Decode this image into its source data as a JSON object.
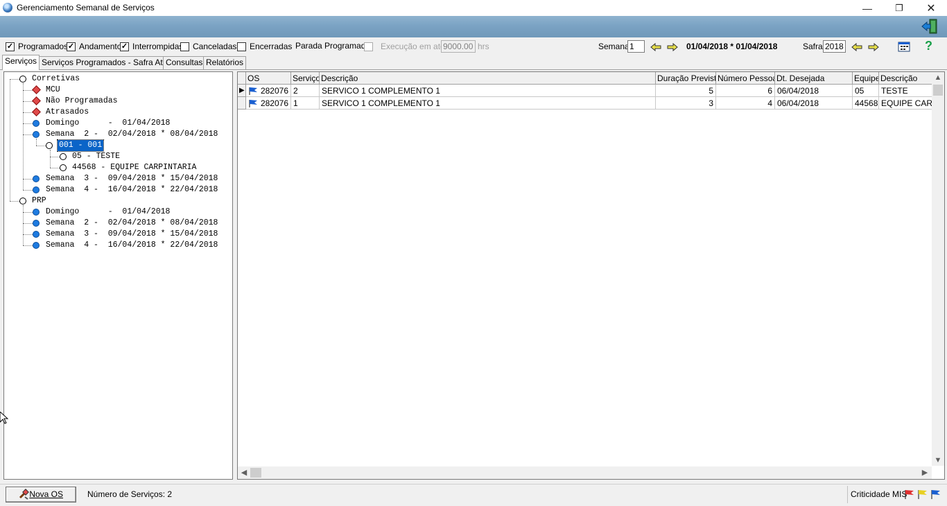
{
  "window": {
    "title": "Gerenciamento Semanal de Serviços"
  },
  "filters": {
    "items": [
      {
        "label": "Programados",
        "checked": true
      },
      {
        "label": "Andamento",
        "checked": true
      },
      {
        "label": "Interrompidas",
        "checked": true
      },
      {
        "label": "Canceladas",
        "checked": false
      },
      {
        "label": "Encerradas",
        "checked": false
      }
    ],
    "parada_label": "Parada Programada",
    "parada_checked": false,
    "execucao_label": "Execução em até",
    "execucao_value": "9000.00",
    "execucao_unit": "hrs",
    "semana_label": "Semana",
    "semana_value": "1",
    "date_range": "01/04/2018 * 01/04/2018",
    "safra_label": "Safra",
    "safra_value": "2018"
  },
  "tabs": [
    {
      "label": "Serviços",
      "active": true
    },
    {
      "label": "Serviços Programados - Safra Atual",
      "active": false
    },
    {
      "label": "Consultas",
      "active": false
    },
    {
      "label": "Relatórios",
      "active": false
    }
  ],
  "tree": [
    {
      "label": "Corretivas",
      "icon": "open-circle-icon",
      "level": 0
    },
    {
      "label": "MCU",
      "icon": "red-diamond-icon",
      "level": 1
    },
    {
      "label": "Não Programadas",
      "icon": "red-diamond-icon",
      "level": 1
    },
    {
      "label": "Atrasados",
      "icon": "red-diamond-icon",
      "level": 1
    },
    {
      "label": "Domingo      -  01/04/2018",
      "icon": "blue-circle-icon",
      "level": 1
    },
    {
      "label": "Semana  2 -  02/04/2018 * 08/04/2018",
      "icon": "blue-circle-icon",
      "level": 1
    },
    {
      "label": "001 - 001",
      "icon": "open-circle-icon",
      "level": 2,
      "selected": true
    },
    {
      "label": "05 - TESTE",
      "icon": "open-circle-icon",
      "level": 3
    },
    {
      "label": "44568 - EQUIPE CARPINTARIA",
      "icon": "open-circle-icon",
      "level": 3
    },
    {
      "label": "Semana  3 -  09/04/2018 * 15/04/2018",
      "icon": "blue-circle-icon",
      "level": 1
    },
    {
      "label": "Semana  4 -  16/04/2018 * 22/04/2018",
      "icon": "blue-circle-icon",
      "level": 1
    },
    {
      "label": "PRP",
      "icon": "open-circle-icon",
      "level": 0
    },
    {
      "label": "Domingo      -  01/04/2018",
      "icon": "blue-circle-icon",
      "level": 1
    },
    {
      "label": "Semana  2 -  02/04/2018 * 08/04/2018",
      "icon": "blue-circle-icon",
      "level": 1
    },
    {
      "label": "Semana  3 -  09/04/2018 * 15/04/2018",
      "icon": "blue-circle-icon",
      "level": 1
    },
    {
      "label": "Semana  4 -  16/04/2018 * 22/04/2018",
      "icon": "blue-circle-icon",
      "level": 1
    }
  ],
  "grid": {
    "columns": [
      "OS",
      "Serviço",
      "Descrição",
      "Duração Prevista",
      "Número Pessoas",
      "Dt. Desejada",
      "Equipe",
      "Descrição"
    ],
    "rows": [
      {
        "os": "282076",
        "servico": "2",
        "descricao": "SERVICO 1 COMPLEMENTO 1",
        "duracao": "5",
        "pessoas": "6",
        "dt": "06/04/2018",
        "equipe": "05",
        "equipe_desc": "TESTE",
        "current": true
      },
      {
        "os": "282076",
        "servico": "1",
        "descricao": "SERVICO 1 COMPLEMENTO 1",
        "duracao": "3",
        "pessoas": "4",
        "dt": "06/04/2018",
        "equipe": "44568",
        "equipe_desc": "EQUIPE CARP",
        "current": false
      }
    ]
  },
  "status": {
    "nova_os": "Nova OS",
    "num_servicos": "Número de Serviços: 2",
    "criticidade": "Criticidade MIS"
  },
  "colors": {
    "banner": "#7ba3c4",
    "selection": "#0a64c8",
    "tree_blue": "#1e7be0",
    "tree_red": "#e04a4a",
    "flag_blue": "#1a5fd0"
  }
}
